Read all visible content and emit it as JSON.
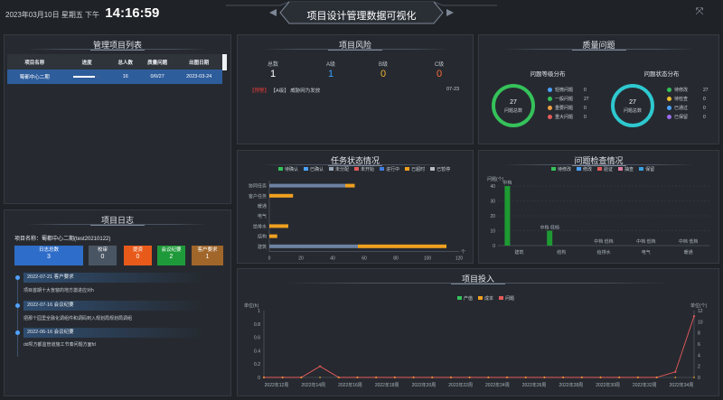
{
  "header": {
    "date": "2023年03月10日 星期五 下午",
    "time": "14:16:59",
    "title": "项目设计管理数据可视化"
  },
  "project_list": {
    "title": "管理项目列表",
    "columns": [
      "项目名称",
      "进度",
      "总人数",
      "质量问题",
      "出图日期"
    ],
    "rows": [
      {
        "name": "蜀都中心二期",
        "progress": 0.8,
        "people": "16",
        "quality": "0/0/27",
        "date": "2023-03-24"
      }
    ]
  },
  "risk": {
    "title": "项目风险",
    "headers": [
      "总数",
      "A级",
      "B级",
      "C级"
    ],
    "values": [
      "1",
      "1",
      "0",
      "0"
    ],
    "alert_tag": "【预警】",
    "alert_text": "【A级】 威胁网为发放",
    "alert_date": "07-23"
  },
  "quality": {
    "title": "质量问题",
    "level_title": "问题等级分布",
    "status_title": "问题状态分布",
    "level_total": "27",
    "level_caption": "问题总数",
    "status_total": "27",
    "status_caption": "问题总数",
    "level_legend": [
      {
        "label": "轻微问题",
        "value": "0",
        "color": "#4aa3ff"
      },
      {
        "label": "一般问题",
        "value": "27",
        "color": "#35c25a"
      },
      {
        "label": "重要问题",
        "value": "0",
        "color": "#f0a040"
      },
      {
        "label": "重大问题",
        "value": "0",
        "color": "#e55a5a"
      }
    ],
    "status_legend": [
      {
        "label": "待修改",
        "value": "27",
        "color": "#35c25a"
      },
      {
        "label": "待检查",
        "value": "0",
        "color": "#f0c030"
      },
      {
        "label": "已通过",
        "value": "0",
        "color": "#4aa3ff"
      },
      {
        "label": "已保留",
        "value": "0",
        "color": "#9a6cf0"
      }
    ]
  },
  "task_chart": {
    "title": "任务状态情况",
    "legend": [
      {
        "label": "待确认",
        "color": "#35c25a"
      },
      {
        "label": "已确认",
        "color": "#4aa3ff"
      },
      {
        "label": "未分配",
        "color": "#9aa7b6"
      },
      {
        "label": "未开始",
        "color": "#e55a5a"
      },
      {
        "label": "进行中",
        "color": "#3f7be0"
      },
      {
        "label": "已超时",
        "color": "#f0a020"
      },
      {
        "label": "已暂停",
        "color": "#b8bec6"
      }
    ],
    "categories": [
      "协同任务",
      "客户任务",
      "暖通",
      "电气",
      "给排水",
      "结构",
      "建筑"
    ],
    "x_ticks": [
      "0",
      "20",
      "40",
      "60",
      "80",
      "100",
      "120"
    ],
    "x_unit": "个"
  },
  "issue_chart": {
    "title": "问题检查情况",
    "legend": [
      {
        "label": "待修改",
        "color": "#35c25a"
      },
      {
        "label": "修改",
        "color": "#4aa3ff"
      },
      {
        "label": "验证",
        "color": "#e55a5a"
      },
      {
        "label": "抽查",
        "color": "#e07aa0"
      },
      {
        "label": "保留",
        "color": "#3aa0e0"
      }
    ],
    "y_label": "问题(个)",
    "y_ticks": [
      "40",
      "30",
      "20",
      "10",
      "0"
    ],
    "categories": [
      "建筑",
      "结构",
      "给排水",
      "电气",
      "暖通"
    ],
    "bar_labels": [
      "中档",
      "中档 低档"
    ],
    "small_labels": [
      "中档 低档",
      "中档 低档",
      "中档 低档"
    ]
  },
  "log": {
    "title": "项目日志",
    "project_name": "项目名称：蜀都中心二期(test20210122)",
    "stats": [
      {
        "label": "日志总数",
        "value": "3",
        "color": "#2e6dc9"
      },
      {
        "label": "校审",
        "value": "0",
        "color": "#4a5563"
      },
      {
        "label": "提资",
        "value": "0",
        "color": "#e85a1a"
      },
      {
        "label": "会议纪要",
        "value": "2",
        "color": "#1f9a3a"
      },
      {
        "label": "客户要求",
        "value": "1",
        "color": "#a0662a"
      }
    ],
    "entries": [
      {
        "head": "2022-07-21  客户要求",
        "body": "项目首期十大盲窗的地方激进应对h"
      },
      {
        "head": "2022-07-16  会议纪要",
        "body": "把那个园里全融化调组件和调码到入规划局规划局调组"
      },
      {
        "head": "2022-06-16  会议纪要",
        "body": "dd坝方都监管道施工节奏问题方面fd"
      }
    ]
  },
  "investment": {
    "title": "项目投入",
    "legend": [
      {
        "label": "产值",
        "color": "#35c25a"
      },
      {
        "label": "成本",
        "color": "#f0a020"
      },
      {
        "label": "问题",
        "color": "#e55a5a"
      }
    ],
    "unit_left": "单位(h)",
    "unit_right": "单位(个)",
    "y_ticks_left": [
      "1",
      "0.8",
      "0.6",
      "0.4",
      "0.2",
      "0"
    ],
    "y_ticks_right": [
      "12",
      "10",
      "8",
      "6",
      "4",
      "2",
      "0"
    ]
  },
  "chart_data": [
    {
      "type": "bar",
      "title": "任务状态情况",
      "categories": [
        "协同任务",
        "客户任务",
        "暖通",
        "电气",
        "给排水",
        "结构",
        "建筑"
      ],
      "series": [
        {
          "name": "未分配",
          "values": [
            48,
            0,
            0,
            0,
            0,
            0,
            56
          ]
        },
        {
          "name": "已超时",
          "values": [
            6,
            15,
            0,
            0,
            12,
            5,
            56
          ]
        }
      ],
      "xlim": [
        0,
        120
      ]
    },
    {
      "type": "bar",
      "title": "问题检查情况",
      "categories": [
        "建筑",
        "结构",
        "给排水",
        "电气",
        "暖通"
      ],
      "series": [
        {
          "name": "待修改",
          "values": [
            40,
            10,
            0,
            0,
            0
          ]
        }
      ],
      "ylabel": "问题(个)",
      "ylim": [
        0,
        40
      ]
    },
    {
      "type": "line",
      "title": "项目投入",
      "x": [
        "2022年12周",
        "2022年14周",
        "2022年16周",
        "2022年18周",
        "2022年20周",
        "2022年22周",
        "2022年24周",
        "2022年26周",
        "2022年28周",
        "2022年30周",
        "2022年32周",
        "2022年34周"
      ],
      "series": [
        {
          "name": "问题",
          "values": [
            0,
            0,
            0,
            2,
            0,
            0,
            0,
            0,
            0,
            0,
            0,
            0,
            0,
            0,
            0,
            0,
            0,
            0,
            0,
            0,
            0,
            0,
            1,
            11
          ]
        }
      ],
      "ylabel": "单位(h)",
      "ylim": [
        0,
        12
      ]
    }
  ]
}
